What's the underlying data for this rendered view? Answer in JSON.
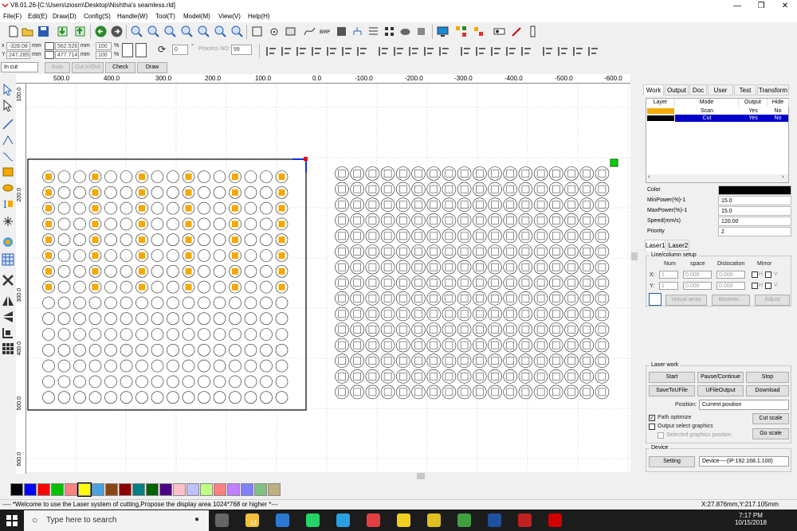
{
  "window": {
    "title": "V8.01.26-[C:\\Users\\ziosm\\Desktop\\Nishtha's seamless.rld]",
    "minimize_glyph": "—",
    "maximize_glyph": "❐",
    "close_glyph": "✕"
  },
  "menu": [
    "File(F)",
    "Edit(E)",
    "Draw(D)",
    "Config(S)",
    "Handle(W)",
    "Tool(T)",
    "Model(M)",
    "View(V)",
    "Help(H)"
  ],
  "toolbar2": {
    "x_label": "x",
    "y_label": "Y",
    "x_value": "-328.08",
    "y_value": "247.285",
    "unit_mm": "mm",
    "w_value": "562.526",
    "h_value": "477.714",
    "scale_x": "100",
    "scale_y": "100",
    "percent": "%",
    "rotate_value": "0",
    "degree": "°",
    "process_no_label": "Process NO:",
    "process_no_value": "99"
  },
  "toolbar3": {
    "layer_mode": "In cut",
    "auto": "Auto",
    "cut_inout": "Cut In/Out",
    "check": "Check",
    "draw": "Draw"
  },
  "hruler_labels": [
    "500.0",
    "400.0",
    "300.0",
    "200.0",
    "100.0",
    "0.0",
    "-100.0",
    "-200.0",
    "-300.0",
    "-400.0",
    "-500.0",
    "-600.0"
  ],
  "vruler_labels": [
    "100.0",
    "200.0",
    "300.0",
    "400.0",
    "500.0",
    "600.0"
  ],
  "palette": [
    "#000000",
    "#0000ff",
    "#ff0000",
    "#00c000",
    "#ff8080",
    "#ffff00",
    "#4aa3e0",
    "#8b4513",
    "#8b0000",
    "#008080",
    "#006400",
    "#4b0082",
    "#ffc0cb",
    "#c0c0ff",
    "#c0ff80",
    "#ff8080",
    "#c080ff",
    "#8080ff",
    "#80c080",
    "#c0b080"
  ],
  "status": {
    "message": "---- *Welcome to use the Laser system of cutting,Propose the display area 1024*768 or higher *---",
    "coords": "X:27.876mm,Y:217.105mm"
  },
  "rightpanel": {
    "tabs": [
      "Work",
      "Output",
      "Doc",
      "User",
      "Test",
      "Transform"
    ],
    "layer_headers": [
      "Layer",
      "Mode",
      "Output",
      "Hide"
    ],
    "layers": [
      {
        "color": "#f5a800",
        "mode": "Scan",
        "output": "Yes",
        "hide": "No",
        "selected": false
      },
      {
        "color": "#000000",
        "mode": "Cut",
        "output": "Yes",
        "hide": "No",
        "selected": true
      }
    ],
    "props": [
      {
        "label": "Color",
        "value": ""
      },
      {
        "label": "MinPower(%)-1",
        "value": "15.0"
      },
      {
        "label": "MaxPower(%)-1",
        "value": "15.0"
      },
      {
        "label": "Speed(mm/s)",
        "value": "120.00"
      },
      {
        "label": "Priority",
        "value": "2"
      }
    ],
    "laser_tabs": [
      "Laser1",
      "Laser2"
    ],
    "line_column": {
      "title": "Line/column setup",
      "headers": [
        "Num",
        "space",
        "Dislocation",
        "Mirror"
      ],
      "x_label": "X:",
      "y_label": "Y:",
      "x_num": "1",
      "x_space": "0.000",
      "x_dis": "0.000",
      "y_num": "1",
      "y_space": "0.000",
      "y_dis": "0.000",
      "h": "H",
      "v": "V",
      "virtual_array": "Virtual array",
      "bestrew": "Bestrew...",
      "adjust": "Adjust"
    },
    "laser_work": {
      "title": "Laser work",
      "start": "Start",
      "pause": "Pause/Continue",
      "stop": "Stop",
      "save_ufile": "SaveToUFile",
      "ufile_output": "UFileOutput",
      "download": "Download",
      "position_label": "Position:",
      "position_value": "Current position",
      "path_optimize": "Path optimize",
      "output_select": "Output select graphics",
      "selected_pos": "Selected graphics position",
      "cut_scale": "Cut scale",
      "go_scale": "Go scale"
    },
    "device": {
      "title": "Device",
      "setting": "Setting",
      "value": "Device----(IP:192.168.1.100)"
    }
  },
  "taskbar": {
    "search_placeholder": "Type here to search",
    "time": "7:17 PM",
    "date": "10/15/2018",
    "badge": "12"
  }
}
